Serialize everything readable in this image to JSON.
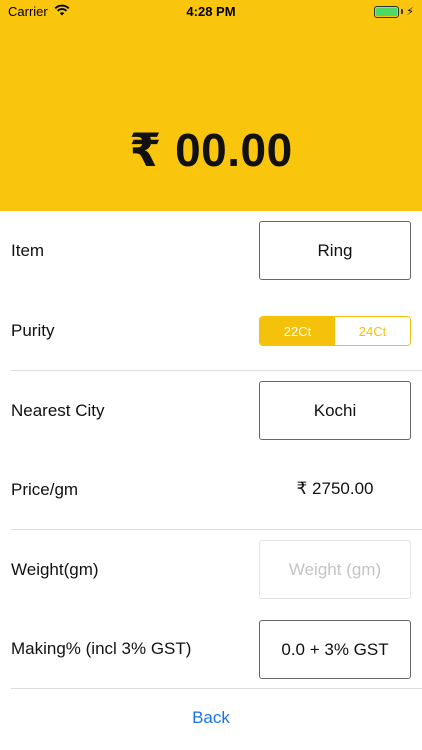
{
  "status_bar": {
    "carrier": "Carrier",
    "time": "4:28 PM",
    "wifi_icon": "wifi-icon",
    "battery_icon": "battery-icon",
    "battery_level": 1.0
  },
  "header": {
    "amount": "₹ 00.00",
    "background_color": "#f9c50d"
  },
  "form": {
    "item": {
      "label": "Item",
      "value": "Ring"
    },
    "purity": {
      "label": "Purity",
      "options": [
        "22Ct",
        "24Ct"
      ],
      "selected": "22Ct"
    },
    "nearest_city": {
      "label": "Nearest City",
      "value": "Kochi"
    },
    "price_per_gm": {
      "label": "Price/gm",
      "value": "₹ 2750.00"
    },
    "weight": {
      "label": "Weight(gm)",
      "placeholder": "Weight (gm)"
    },
    "making": {
      "label": "Making% (incl 3% GST)",
      "value": "0.0 + 3% GST"
    }
  },
  "footer": {
    "back_label": "Back",
    "accent_color": "#1a73e8"
  }
}
